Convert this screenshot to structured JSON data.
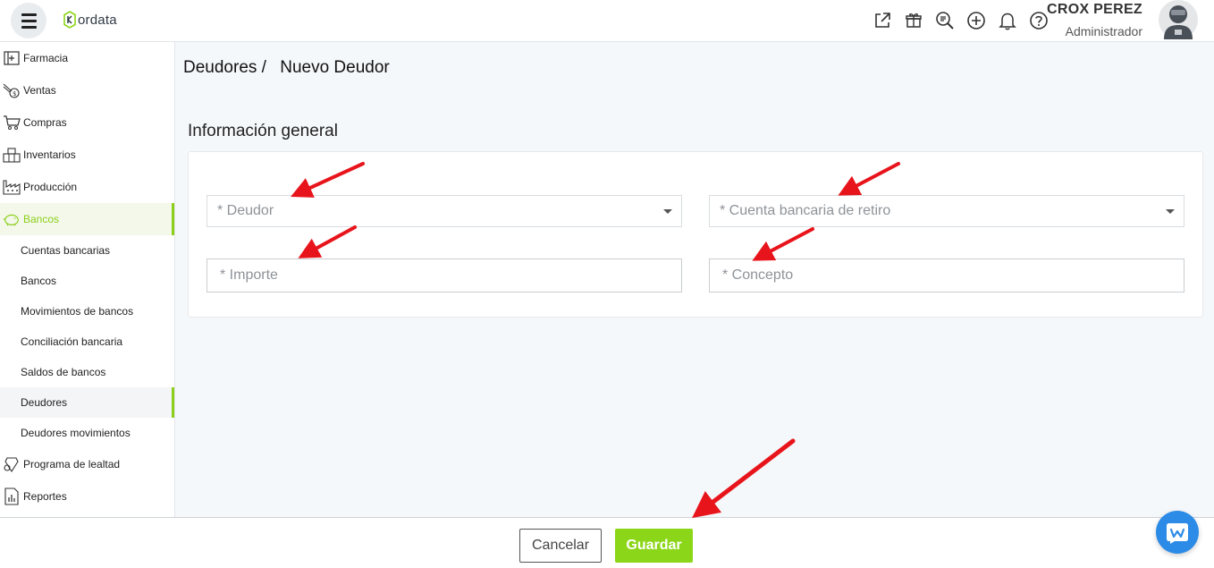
{
  "header": {
    "brand": "ordata",
    "user_name": "CROX PEREZ",
    "user_role": "Administrador",
    "icons": [
      "external-link-icon",
      "gift-icon",
      "zoom-search-icon",
      "plus-circle-icon",
      "bell-icon",
      "help-icon"
    ]
  },
  "sidebar": {
    "items": [
      {
        "label": "Farmacia",
        "icon": "pharmacy-icon"
      },
      {
        "label": "Ventas",
        "icon": "sales-icon"
      },
      {
        "label": "Compras",
        "icon": "cart-icon"
      },
      {
        "label": "Inventarios",
        "icon": "inventory-icon"
      },
      {
        "label": "Producción",
        "icon": "factory-icon"
      },
      {
        "label": "Bancos",
        "icon": "piggy-bank-icon"
      }
    ],
    "subitems": [
      {
        "label": "Cuentas bancarias"
      },
      {
        "label": "Bancos"
      },
      {
        "label": "Movimientos de bancos"
      },
      {
        "label": "Conciliación bancaria"
      },
      {
        "label": "Saldos de bancos"
      },
      {
        "label": "Deudores"
      },
      {
        "label": "Deudores movimientos"
      }
    ],
    "items_after": [
      {
        "label": "Programa de lealtad",
        "icon": "loyalty-icon"
      },
      {
        "label": "Reportes",
        "icon": "reports-icon"
      }
    ],
    "active_item": "Bancos",
    "active_subitem": "Deudores"
  },
  "main": {
    "breadcrumb_parent": "Deudores /",
    "breadcrumb_current": "Nuevo Deudor",
    "section_title": "Información general",
    "fields": {
      "deudor_placeholder": "* Deudor",
      "cuenta_placeholder": "* Cuenta bancaria de retiro",
      "importe_placeholder": "* Importe",
      "concepto_placeholder": "* Concepto"
    }
  },
  "footer": {
    "cancel_label": "Cancelar",
    "save_label": "Guardar"
  },
  "colors": {
    "accent": "#8cd61a",
    "annotation": "#e8141b",
    "chat": "#2c8be6"
  }
}
